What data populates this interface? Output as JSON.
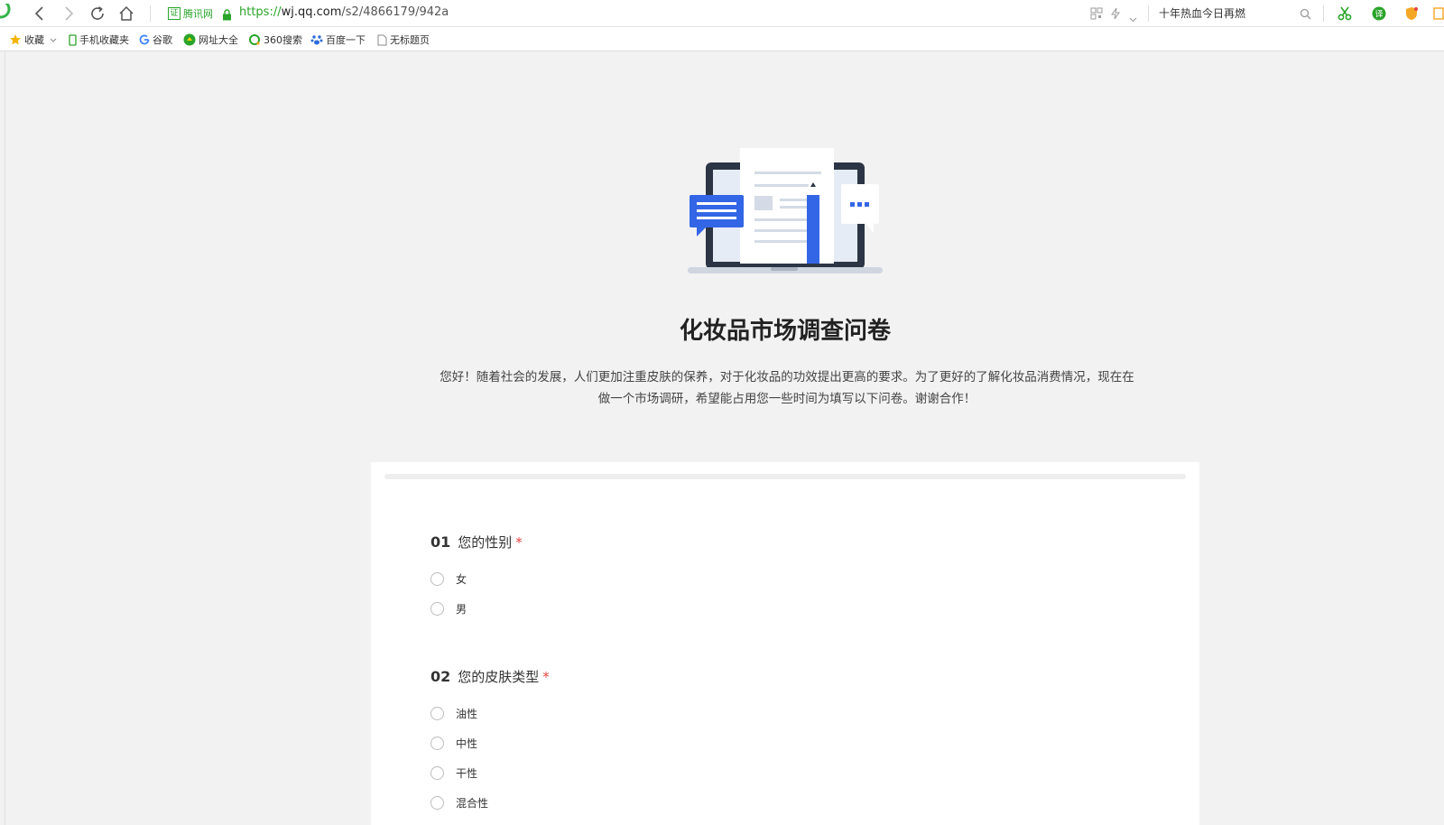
{
  "browser": {
    "cert_label": "腾讯网",
    "cert_badge": "证",
    "url_scheme": "https://",
    "url_host": "wj.qq.com",
    "url_path": "/s2/4866179/942a",
    "news_text": "十年热血今日再燃"
  },
  "bookmarks": [
    {
      "label": "收藏"
    },
    {
      "label": "手机收藏夹"
    },
    {
      "label": "谷歌"
    },
    {
      "label": "网址大全"
    },
    {
      "label": "360搜索"
    },
    {
      "label": "百度一下"
    },
    {
      "label": "无标题页"
    }
  ],
  "survey": {
    "title": "化妆品市场调查问卷",
    "intro": "您好！随着社会的发展，人们更加注重皮肤的保养，对于化妆品的功效提出更高的要求。为了更好的了解化妆品消费情况，现在在做一个市场调研，希望能占用您一些时间为填写以下问卷。谢谢合作！",
    "questions": [
      {
        "num": "01",
        "text": "您的性别",
        "required": "*",
        "options": [
          "女",
          "男"
        ]
      },
      {
        "num": "02",
        "text": "您的皮肤类型",
        "required": "*",
        "options": [
          "油性",
          "中性",
          "干性",
          "混合性"
        ]
      }
    ]
  },
  "colors": {
    "accent_green": "#2aa42a",
    "required_red": "#e64340",
    "hero_blue": "#3366e6"
  }
}
